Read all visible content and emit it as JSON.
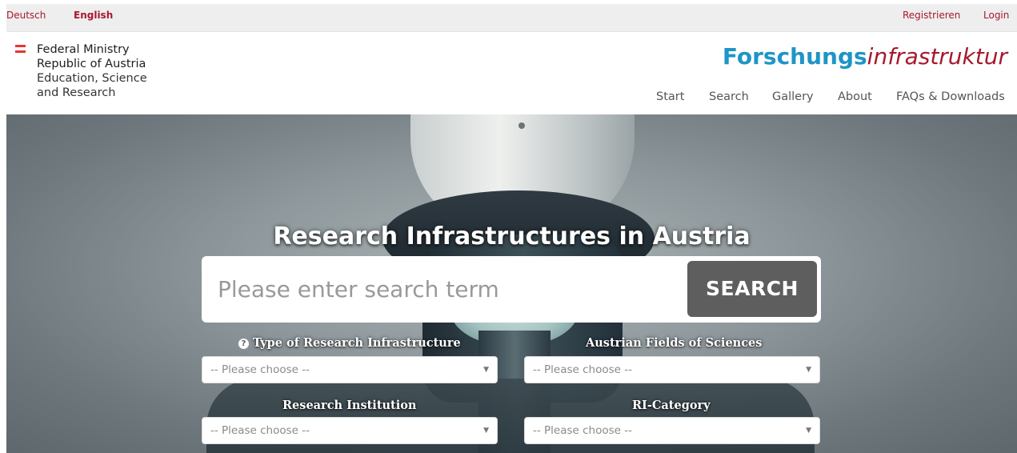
{
  "topbar": {
    "lang_de": "Deutsch",
    "lang_en": "English",
    "register": "Registrieren",
    "login": "Login"
  },
  "header": {
    "ministry_line1": "Federal Ministry",
    "ministry_line2": "Republic of Austria",
    "ministry_line3": "Education, Science",
    "ministry_line4": "and Research",
    "brand_bold": "Forschungs",
    "brand_italic": "infrastruktur",
    "nav": [
      "Start",
      "Search",
      "Gallery",
      "About",
      "FAQs & Downloads"
    ]
  },
  "hero": {
    "title": "Research Infrastructures in Austria",
    "search_placeholder": "Please enter search term",
    "search_button": "SEARCH",
    "filters": {
      "type_label": "Type of Research Infrastructure",
      "type_value": "-- Please choose --",
      "fields_label": "Austrian Fields of Sciences",
      "fields_value": "-- Please choose --",
      "institution_label": "Research Institution",
      "institution_value": "-- Please choose --",
      "category_label": "RI-Category",
      "category_value": "-- Please choose --"
    }
  },
  "colors": {
    "accent_red": "#a6192e",
    "brand_blue": "#1e95c6",
    "search_button_bg": "#5e5e5e"
  },
  "icons": {
    "flag": "austria-flag-icon",
    "help": "question-circle-icon",
    "caret": "caret-down-icon"
  }
}
